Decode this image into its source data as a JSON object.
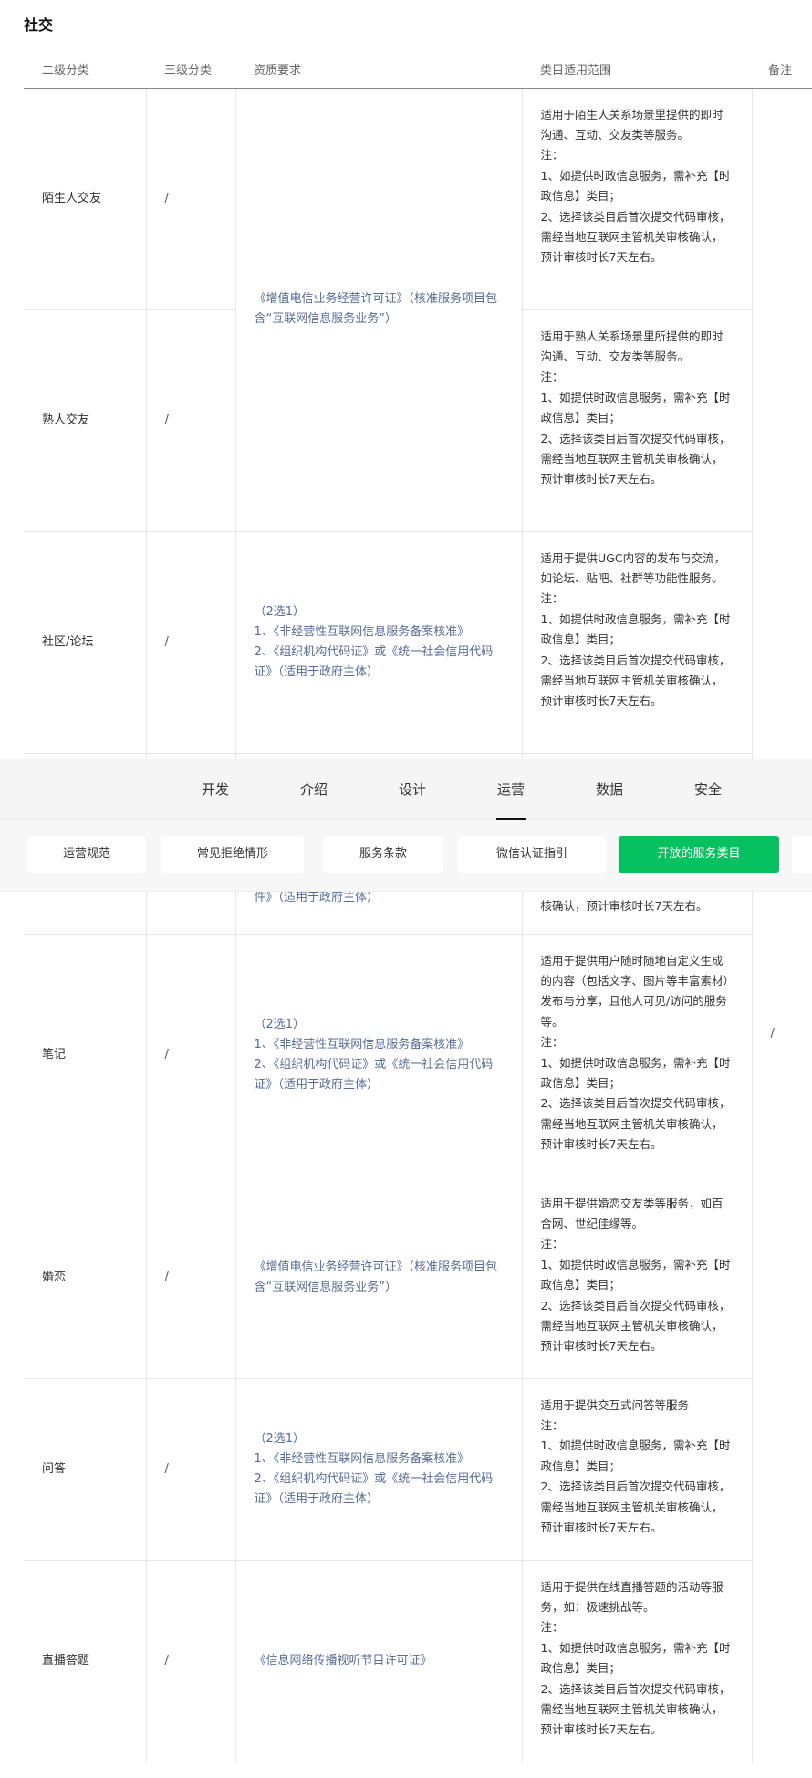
{
  "section_title": "社交",
  "table": {
    "headers": [
      "二级分类",
      "三级分类",
      "资质要求",
      "类目适用范围",
      "备注"
    ],
    "req_text": {
      "icp": "《增值电信业务经营许可证》（核准服务项目包含“互联网信息服务业务”）",
      "two_choice_1": "（2选1）",
      "two_choice_2": "1、《非经营性互联网信息服务备案核准》",
      "two_choice_3": "2、《组织机构代码证》或《统一社会信用代码证》（适用于政府主体）",
      "partial_tail": "件》（适用于政府主体）",
      "tv": "《信息网络传播视听节目许可证》"
    },
    "note_value": "/",
    "rows": [
      {
        "c2": "陌生人交友",
        "c3": "/",
        "scope": [
          "适用于陌生人关系场景里提供的即时沟通、互动、交友类等服务。",
          "注：",
          "1、如提供时政信息服务，需补充【时政信息】类目；",
          "2、选择该类目后首次提交代码审核，需经当地互联网主管机关审核确认，预计审核时长7天左右。"
        ]
      },
      {
        "c2": "熟人交友",
        "c3": "/",
        "scope": [
          "适用于熟人关系场景里所提供的即时沟通、互动、交友类等服务。",
          "注：",
          "1、如提供时政信息服务，需补充【时政信息】类目；",
          "2、选择该类目后首次提交代码审核，需经当地互联网主管机关审核确认，预计审核时长7天左右。"
        ]
      },
      {
        "c2": "社区/论坛",
        "c3": "/",
        "scope": [
          "适用于提供UGC内容的发布与交流，如论坛、贴吧、社群等功能性服务。",
          "注：",
          "1、如提供时政信息服务，需补充【时政信息】类目；",
          "2、选择该类目后首次提交代码审核，需经当地互联网主管机关审核确认，预计审核时长7天左右。"
        ]
      },
      {
        "c2": "",
        "c3": "",
        "scope": [
          "核确认，预计审核时长7天左右。"
        ]
      },
      {
        "c2": "笔记",
        "c3": "/",
        "scope": [
          "适用于提供用户随时随地自定义生成的内容（包括文字、图片等丰富素材）发布与分享，且他人可见/访问的服务等。",
          "注：",
          "1、如提供时政信息服务，需补充【时政信息】类目；",
          "2、选择该类目后首次提交代码审核，需经当地互联网主管机关审核确认，预计审核时长7天左右。"
        ]
      },
      {
        "c2": "婚恋",
        "c3": "/",
        "scope": [
          "适用于提供婚恋交友类等服务，如百合网、世纪佳缘等。",
          "注：",
          "1、如提供时政信息服务，需补充【时政信息】类目；",
          "2、选择该类目后首次提交代码审核，需经当地互联网主管机关审核确认，预计审核时长7天左右。"
        ]
      },
      {
        "c2": "问答",
        "c3": "/",
        "scope": [
          "适用于提供交互式问答等服务",
          "注：",
          "1、如提供时政信息服务，需补充【时政信息】类目；",
          "2、选择该类目后首次提交代码审核，需经当地互联网主管机关审核确认，预计审核时长7天左右。"
        ]
      },
      {
        "c2": "直播答题",
        "c3": "/",
        "scope": [
          "适用于提供在线直播答题的活动等服务，如：极速挑战等。",
          "注：",
          "1、如提供时政信息服务，需补充【时政信息】类目；",
          "2、选择该类目后首次提交代码审核，需经当地互联网主管机关审核确认，预计审核时长7天左右。"
        ]
      }
    ]
  },
  "nav": {
    "tabs": [
      "开发",
      "介绍",
      "设计",
      "运营",
      "数据",
      "安全"
    ],
    "active_tab": "运营",
    "subnav": [
      "运营规范",
      "常见拒绝情形",
      "服务条款",
      "微信认证指引",
      "开放的服务类目"
    ],
    "active_sub": "开放的服务类目"
  },
  "colors": {
    "accent_green": "#07c160",
    "link_blue": "#576b95"
  }
}
